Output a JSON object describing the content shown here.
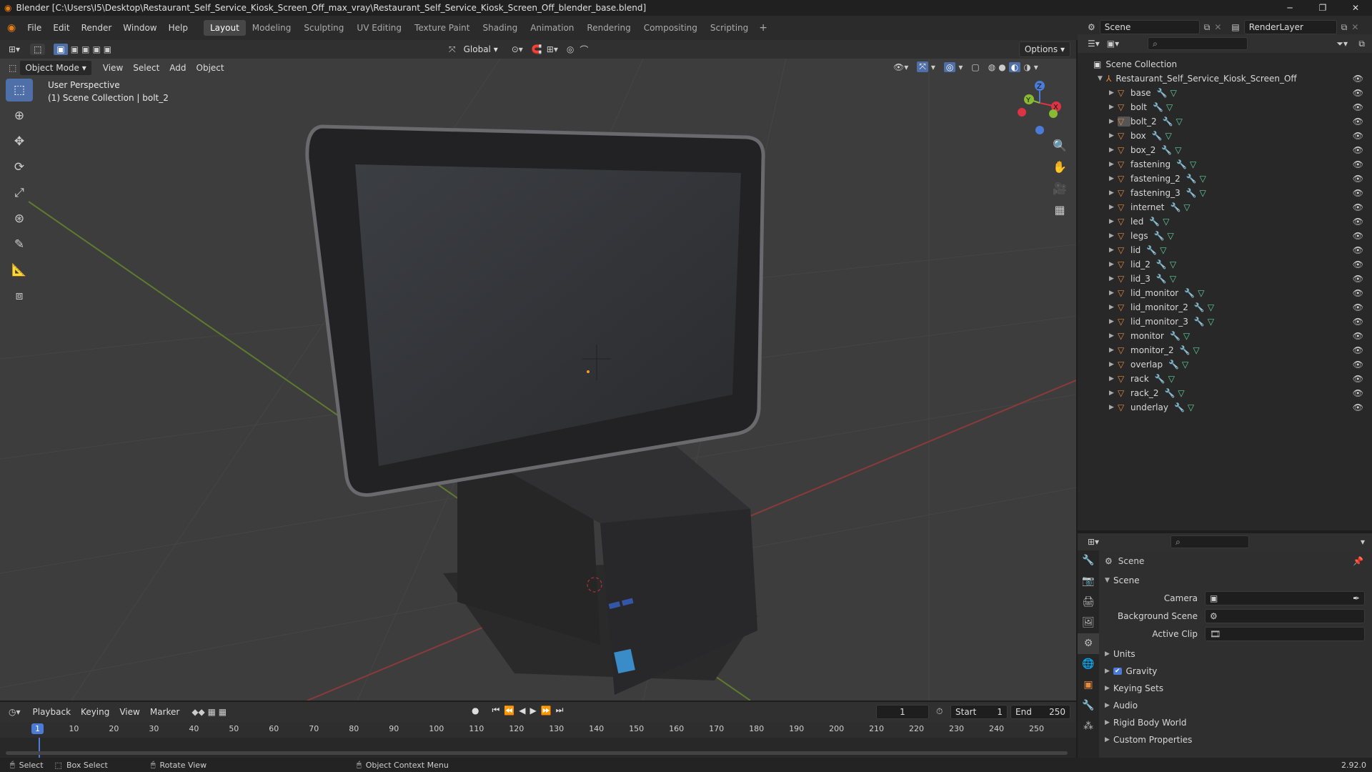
{
  "title": "Blender [C:\\Users\\I5\\Desktop\\Restaurant_Self_Service_Kiosk_Screen_Off_max_vray\\Restaurant_Self_Service_Kiosk_Screen_Off_blender_base.blend]",
  "menu": [
    "File",
    "Edit",
    "Render",
    "Window",
    "Help"
  ],
  "workspaces": [
    "Layout",
    "Modeling",
    "Sculpting",
    "UV Editing",
    "Texture Paint",
    "Shading",
    "Animation",
    "Rendering",
    "Compositing",
    "Scripting"
  ],
  "scene_name": "Scene",
  "render_layer": "RenderLayer",
  "toolheader": {
    "orientation": "Global",
    "options": "Options"
  },
  "viewport_header": {
    "mode": "Object Mode",
    "items": [
      "View",
      "Select",
      "Add",
      "Object"
    ]
  },
  "viewport_info": {
    "line1": "User Perspective",
    "line2": "(1) Scene Collection | bolt_2"
  },
  "gizmo": {
    "x": "X",
    "y": "Y",
    "z": "Z"
  },
  "outliner": {
    "root": "Scene Collection",
    "collection": "Restaurant_Self_Service_Kiosk_Screen_Off",
    "objects": [
      "base",
      "bolt",
      "bolt_2",
      "box",
      "box_2",
      "fastening",
      "fastening_2",
      "fastening_3",
      "internet",
      "led",
      "legs",
      "lid",
      "lid_2",
      "lid_3",
      "lid_monitor",
      "lid_monitor_2",
      "lid_monitor_3",
      "monitor",
      "monitor_2",
      "overlap",
      "rack",
      "rack_2",
      "underlay"
    ]
  },
  "properties": {
    "header": "Scene",
    "panel": "Scene",
    "fields": [
      {
        "label": "Camera"
      },
      {
        "label": "Background Scene"
      },
      {
        "label": "Active Clip"
      }
    ],
    "sections": [
      "Units",
      "Gravity",
      "Keying Sets",
      "Audio",
      "Rigid Body World",
      "Custom Properties"
    ]
  },
  "timeline": {
    "menus": [
      "Playback",
      "Keying",
      "View",
      "Marker"
    ],
    "current_frame": "1",
    "start_label": "Start",
    "start": "1",
    "end_label": "End",
    "end": "250",
    "ticks": [
      "10",
      "20",
      "30",
      "40",
      "50",
      "60",
      "70",
      "80",
      "90",
      "100",
      "110",
      "120",
      "130",
      "140",
      "150",
      "160",
      "170",
      "180",
      "190",
      "200",
      "210",
      "220",
      "230",
      "240",
      "250"
    ]
  },
  "status": {
    "select": "Select",
    "box_select": "Box Select",
    "rotate": "Rotate View",
    "context": "Object Context Menu",
    "version": "2.92.0"
  }
}
